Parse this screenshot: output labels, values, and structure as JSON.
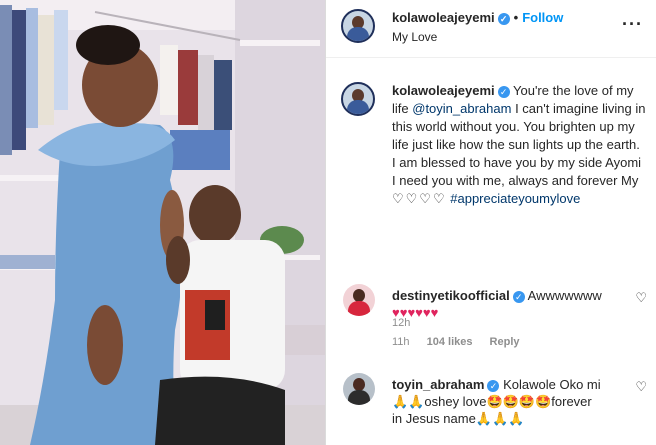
{
  "post": {
    "username": "kolawoleajeyemi",
    "follow_label": "Follow",
    "location": "My Love",
    "more_icon": "more-options-icon",
    "colors": {
      "accent": "#0095f6",
      "verified": "#3897f0",
      "muted": "#8e8e8e"
    }
  },
  "caption": {
    "username": "kolawoleajeyemi",
    "text_part1": "You're the love of my life",
    "mention": "@toyin_abraham",
    "text_part2": "I can't imagine living in this world without you. You brighten up my life just like how the sun lights up the earth. I am blessed to have you by my side Ayomi I need you with me, always and forever My",
    "hearts": "♡♡♡♡",
    "hashtag": "#appreciateyoumylove",
    "time": "12h"
  },
  "comments": [
    {
      "username": "destinyetikoofficial",
      "text": "Awwwwwww",
      "emoji_line": "♥♥♥♥♥♥",
      "time": "11h",
      "likes": "104 likes",
      "reply_label": "Reply"
    },
    {
      "username": "toyin_abraham",
      "text_line1": "Kolawole Oko mi",
      "text_line2": "🙏🙏oshey love🤩🤩🤩🤩forever",
      "text_line3": "in Jesus name🙏🙏🙏"
    }
  ]
}
